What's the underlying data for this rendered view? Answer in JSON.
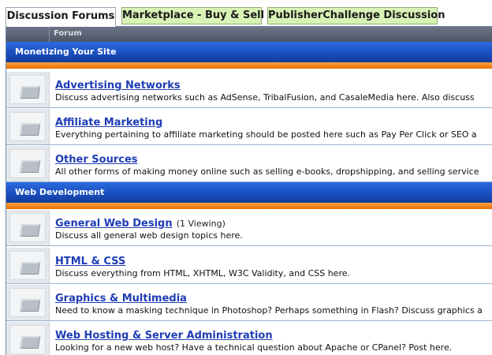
{
  "tabs": [
    {
      "label": "Discussion Forums",
      "active": true
    },
    {
      "label": "Marketplace - Buy & Sell",
      "active": false
    },
    {
      "label": "PublisherChallenge Discussion",
      "active": false
    }
  ],
  "table": {
    "column_header": "Forum"
  },
  "categories": [
    {
      "title": "Monetizing Your Site",
      "forums": [
        {
          "title": "Advertising Networks",
          "viewing": "",
          "description": "Discuss advertising networks such as AdSense, TribalFusion, and CasaleMedia here. Also discuss"
        },
        {
          "title": "Affiliate Marketing",
          "viewing": "",
          "description": "Everything pertaining to affiliate marketing should be posted here such as Pay Per Click or SEO a"
        },
        {
          "title": "Other Sources",
          "viewing": "",
          "description": "All other forms of making money online such as selling e-books, dropshipping, and selling service"
        }
      ]
    },
    {
      "title": "Web Development",
      "forums": [
        {
          "title": "General Web Design",
          "viewing": "(1 Viewing)",
          "description": "Discuss all general web design topics here."
        },
        {
          "title": "HTML & CSS",
          "viewing": "",
          "description": "Discuss everything from HTML, XHTML, W3C Validity, and CSS here."
        },
        {
          "title": "Graphics & Multimedia",
          "viewing": "",
          "description": "Need to know a masking technique in Photoshop? Perhaps something in Flash? Discuss graphics a"
        },
        {
          "title": "Web Hosting & Server Administration",
          "viewing": "",
          "description": "Looking for a new web host? Have a technical question about Apache or CPanel? Post here."
        }
      ]
    }
  ],
  "colors": {
    "category_bar": "#1a4fbf",
    "orange_strip": "#f08a1c",
    "link": "#1f3db5",
    "tab_inactive": "#d9f2b6"
  },
  "icons": {
    "forum_status": "folder-icon"
  }
}
